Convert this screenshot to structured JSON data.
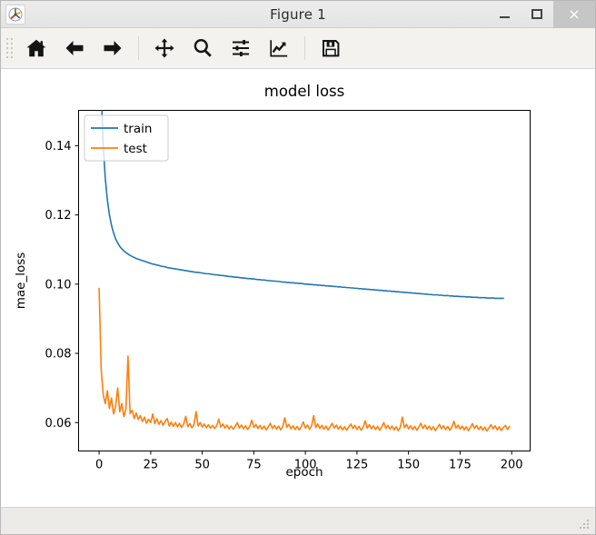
{
  "window": {
    "title": "Figure 1",
    "app_icon": "matplotlib-logo-icon",
    "minimize_label": "–",
    "maximize_label": "□",
    "close_label": "×"
  },
  "toolbar": {
    "buttons": [
      {
        "name": "home-button",
        "tooltip": "Reset original view",
        "icon": "home-icon"
      },
      {
        "name": "back-button",
        "tooltip": "Back to previous view",
        "icon": "arrow-left-icon"
      },
      {
        "name": "forward-button",
        "tooltip": "Forward to next view",
        "icon": "arrow-right-icon"
      },
      {
        "name": "pan-button",
        "tooltip": "Pan axes with left mouse, zoom with right",
        "icon": "move-icon"
      },
      {
        "name": "zoom-button",
        "tooltip": "Zoom to rectangle",
        "icon": "magnifier-icon"
      },
      {
        "name": "subplots-button",
        "tooltip": "Configure subplots",
        "icon": "sliders-icon"
      },
      {
        "name": "customize-button",
        "tooltip": "Edit axis, curve and image parameters",
        "icon": "chart-line-icon"
      },
      {
        "name": "save-button",
        "tooltip": "Save the figure",
        "icon": "floppy-disk-icon"
      }
    ]
  },
  "statusbar": {
    "coordinates": ""
  },
  "chart_data": {
    "type": "line",
    "title": "model loss",
    "xlabel": "epoch",
    "ylabel": "mae_loss",
    "xlim": [
      -9.95,
      208.95
    ],
    "ylim": [
      0.0518,
      0.1502
    ],
    "xticks": [
      0,
      25,
      50,
      75,
      100,
      125,
      150,
      175,
      200
    ],
    "xticklabels": [
      "0",
      "25",
      "50",
      "75",
      "100",
      "125",
      "150",
      "175",
      "200"
    ],
    "yticks": [
      0.06,
      0.08,
      0.1,
      0.12,
      0.14
    ],
    "yticklabels": [
      "0.06",
      "0.08",
      "0.10",
      "0.12",
      "0.14"
    ],
    "grid": false,
    "legend": {
      "position": "upper left",
      "entries": [
        {
          "label": "train",
          "color": "#1f77b4"
        },
        {
          "label": "test",
          "color": "#ff7f0e"
        }
      ]
    },
    "series": [
      {
        "name": "train",
        "color": "#1f77b4",
        "x": [
          0,
          1,
          2,
          3,
          4,
          5,
          6,
          7,
          8,
          9,
          10,
          11,
          12,
          13,
          14,
          15,
          16,
          17,
          18,
          19,
          20,
          21,
          22,
          23,
          24,
          25,
          26,
          27,
          28,
          29,
          30,
          31,
          32,
          33,
          34,
          35,
          36,
          37,
          38,
          39,
          40,
          41,
          42,
          43,
          44,
          45,
          46,
          47,
          48,
          49,
          50,
          51,
          52,
          53,
          54,
          55,
          56,
          57,
          58,
          59,
          60,
          61,
          62,
          63,
          64,
          65,
          66,
          67,
          68,
          69,
          70,
          71,
          72,
          73,
          74,
          75,
          76,
          77,
          78,
          79,
          80,
          81,
          82,
          83,
          84,
          85,
          86,
          87,
          88,
          89,
          90,
          91,
          92,
          93,
          94,
          95,
          96,
          97,
          98,
          99,
          100,
          101,
          102,
          103,
          104,
          105,
          106,
          107,
          108,
          109,
          110,
          111,
          112,
          113,
          114,
          115,
          116,
          117,
          118,
          119,
          120,
          121,
          122,
          123,
          124,
          125,
          126,
          127,
          128,
          129,
          130,
          131,
          132,
          133,
          134,
          135,
          136,
          137,
          138,
          139,
          140,
          141,
          142,
          143,
          144,
          145,
          146,
          147,
          148,
          149,
          150,
          151,
          152,
          153,
          154,
          155,
          156,
          157,
          158,
          159,
          160,
          161,
          162,
          163,
          164,
          165,
          166,
          167,
          168,
          169,
          170,
          171,
          172,
          173,
          174,
          175,
          176,
          177,
          178,
          179,
          180,
          181,
          182,
          183,
          184,
          185,
          186,
          187,
          188,
          189,
          190,
          191,
          192,
          193,
          194,
          195,
          196,
          197,
          198,
          199
        ],
        "y": [
          0.183,
          0.1558,
          0.14,
          0.1305,
          0.1243,
          0.12,
          0.117,
          0.1148,
          0.1131,
          0.1119,
          0.1109,
          0.1102,
          0.1096,
          0.1091,
          0.1087,
          0.1083,
          0.108,
          0.1077,
          0.1074,
          0.1072,
          0.107,
          0.1068,
          0.1066,
          0.1064,
          0.1062,
          0.106,
          0.1058,
          0.1057,
          0.1055,
          0.1054,
          0.1052,
          0.1051,
          0.105,
          0.1048,
          0.1047,
          0.1046,
          0.1045,
          0.1044,
          0.1043,
          0.1042,
          0.1041,
          0.104,
          0.1039,
          0.1038,
          0.1037,
          0.1036,
          0.1035,
          0.1034,
          0.1034,
          0.1033,
          0.1032,
          0.1031,
          0.103,
          0.103,
          0.1029,
          0.1028,
          0.1027,
          0.1027,
          0.1026,
          0.1025,
          0.1025,
          0.1024,
          0.1023,
          0.1022,
          0.1022,
          0.1021,
          0.102,
          0.102,
          0.1019,
          0.1018,
          0.1018,
          0.1017,
          0.1016,
          0.1016,
          0.1015,
          0.1015,
          0.1014,
          0.1013,
          0.1013,
          0.1012,
          0.1012,
          0.1011,
          0.101,
          0.101,
          0.1009,
          0.1009,
          0.1008,
          0.1008,
          0.1007,
          0.1006,
          0.1006,
          0.1005,
          0.1005,
          0.1004,
          0.1004,
          0.1003,
          0.1003,
          0.1002,
          0.1002,
          0.1001,
          0.1,
          0.1,
          0.0999,
          0.0999,
          0.0998,
          0.0998,
          0.0997,
          0.0997,
          0.0996,
          0.0996,
          0.0995,
          0.0995,
          0.0994,
          0.0994,
          0.0993,
          0.0993,
          0.0992,
          0.0992,
          0.0991,
          0.0991,
          0.099,
          0.099,
          0.0989,
          0.0989,
          0.0988,
          0.0988,
          0.0987,
          0.0987,
          0.0986,
          0.0986,
          0.0985,
          0.0985,
          0.0984,
          0.0984,
          0.0983,
          0.0983,
          0.0982,
          0.0982,
          0.0981,
          0.0981,
          0.098,
          0.098,
          0.0979,
          0.0979,
          0.0978,
          0.0978,
          0.0977,
          0.0977,
          0.0976,
          0.0976,
          0.0975,
          0.0975,
          0.0974,
          0.0974,
          0.0973,
          0.0973,
          0.0972,
          0.0972,
          0.0971,
          0.0971,
          0.097,
          0.097,
          0.0969,
          0.0969,
          0.0969,
          0.0968,
          0.0968,
          0.0967,
          0.0967,
          0.0967,
          0.0966,
          0.0966,
          0.0965,
          0.0965,
          0.0965,
          0.0964,
          0.0964,
          0.0964,
          0.0963,
          0.0963,
          0.0963,
          0.0962,
          0.0962,
          0.0962,
          0.0961,
          0.0961,
          0.0961,
          0.0961,
          0.096,
          0.096,
          0.096,
          0.096,
          0.0959,
          0.0959,
          0.0959,
          0.0959,
          0.0959
        ]
      },
      {
        "name": "test",
        "color": "#ff7f0e",
        "x": [
          0,
          1,
          2,
          3,
          4,
          5,
          6,
          7,
          8,
          9,
          10,
          11,
          12,
          13,
          14,
          15,
          16,
          17,
          18,
          19,
          20,
          21,
          22,
          23,
          24,
          25,
          26,
          27,
          28,
          29,
          30,
          31,
          32,
          33,
          34,
          35,
          36,
          37,
          38,
          39,
          40,
          41,
          42,
          43,
          44,
          45,
          46,
          47,
          48,
          49,
          50,
          51,
          52,
          53,
          54,
          55,
          56,
          57,
          58,
          59,
          60,
          61,
          62,
          63,
          64,
          65,
          66,
          67,
          68,
          69,
          70,
          71,
          72,
          73,
          74,
          75,
          76,
          77,
          78,
          79,
          80,
          81,
          82,
          83,
          84,
          85,
          86,
          87,
          88,
          89,
          90,
          91,
          92,
          93,
          94,
          95,
          96,
          97,
          98,
          99,
          100,
          101,
          102,
          103,
          104,
          105,
          106,
          107,
          108,
          109,
          110,
          111,
          112,
          113,
          114,
          115,
          116,
          117,
          118,
          119,
          120,
          121,
          122,
          123,
          124,
          125,
          126,
          127,
          128,
          129,
          130,
          131,
          132,
          133,
          134,
          135,
          136,
          137,
          138,
          139,
          140,
          141,
          142,
          143,
          144,
          145,
          146,
          147,
          148,
          149,
          150,
          151,
          152,
          153,
          154,
          155,
          156,
          157,
          158,
          159,
          160,
          161,
          162,
          163,
          164,
          165,
          166,
          167,
          168,
          169,
          170,
          171,
          172,
          173,
          174,
          175,
          176,
          177,
          178,
          179,
          180,
          181,
          182,
          183,
          184,
          185,
          186,
          187,
          188,
          189,
          190,
          191,
          192,
          193,
          194,
          195,
          196,
          197,
          198,
          199
        ],
        "y": [
          0.0988,
          0.0753,
          0.068,
          0.0655,
          0.0692,
          0.0641,
          0.0671,
          0.0625,
          0.0647,
          0.07,
          0.0631,
          0.0655,
          0.0617,
          0.064,
          0.0792,
          0.0626,
          0.0636,
          0.0612,
          0.0628,
          0.0609,
          0.062,
          0.0603,
          0.0616,
          0.0598,
          0.061,
          0.06,
          0.0625,
          0.0597,
          0.0611,
          0.0595,
          0.0606,
          0.0592,
          0.0604,
          0.0612,
          0.059,
          0.0601,
          0.0589,
          0.06,
          0.0588,
          0.0598,
          0.0586,
          0.0596,
          0.0618,
          0.0588,
          0.0597,
          0.0585,
          0.0594,
          0.0632,
          0.059,
          0.06,
          0.0587,
          0.0596,
          0.0585,
          0.0594,
          0.0584,
          0.0592,
          0.0583,
          0.0591,
          0.061,
          0.0587,
          0.0596,
          0.0584,
          0.0593,
          0.0582,
          0.059,
          0.0581,
          0.0589,
          0.06,
          0.0584,
          0.0593,
          0.0582,
          0.0591,
          0.058,
          0.0589,
          0.0607,
          0.0586,
          0.0595,
          0.0583,
          0.0592,
          0.0581,
          0.059,
          0.0579,
          0.0588,
          0.0598,
          0.0583,
          0.0592,
          0.0581,
          0.059,
          0.0579,
          0.0588,
          0.0614,
          0.0586,
          0.0595,
          0.0582,
          0.0591,
          0.058,
          0.0589,
          0.0579,
          0.0588,
          0.0602,
          0.0584,
          0.0593,
          0.0581,
          0.059,
          0.062,
          0.0586,
          0.0596,
          0.0583,
          0.0592,
          0.0581,
          0.059,
          0.0579,
          0.0588,
          0.0598,
          0.0584,
          0.0593,
          0.0581,
          0.059,
          0.0579,
          0.0588,
          0.0578,
          0.0587,
          0.0596,
          0.0583,
          0.0592,
          0.058,
          0.0589,
          0.0578,
          0.0587,
          0.0605,
          0.0584,
          0.0594,
          0.0582,
          0.0591,
          0.058,
          0.0589,
          0.0578,
          0.0587,
          0.06,
          0.0583,
          0.0592,
          0.0581,
          0.059,
          0.0579,
          0.0588,
          0.0577,
          0.0586,
          0.0616,
          0.0585,
          0.0595,
          0.0582,
          0.0591,
          0.058,
          0.0589,
          0.0578,
          0.0587,
          0.0598,
          0.0583,
          0.0593,
          0.0581,
          0.059,
          0.0579,
          0.0588,
          0.0577,
          0.0586,
          0.0595,
          0.0582,
          0.0591,
          0.058,
          0.0589,
          0.0578,
          0.0587,
          0.0604,
          0.0584,
          0.0593,
          0.0581,
          0.059,
          0.0579,
          0.0588,
          0.0577,
          0.0586,
          0.0597,
          0.0583,
          0.0592,
          0.058,
          0.0589,
          0.0578,
          0.0587,
          0.0576,
          0.0585,
          0.0594,
          0.0582,
          0.0591,
          0.0579,
          0.0588,
          0.0577,
          0.0586,
          0.0592,
          0.058,
          0.0589,
          0.0578,
          0.0585
        ]
      }
    ]
  }
}
